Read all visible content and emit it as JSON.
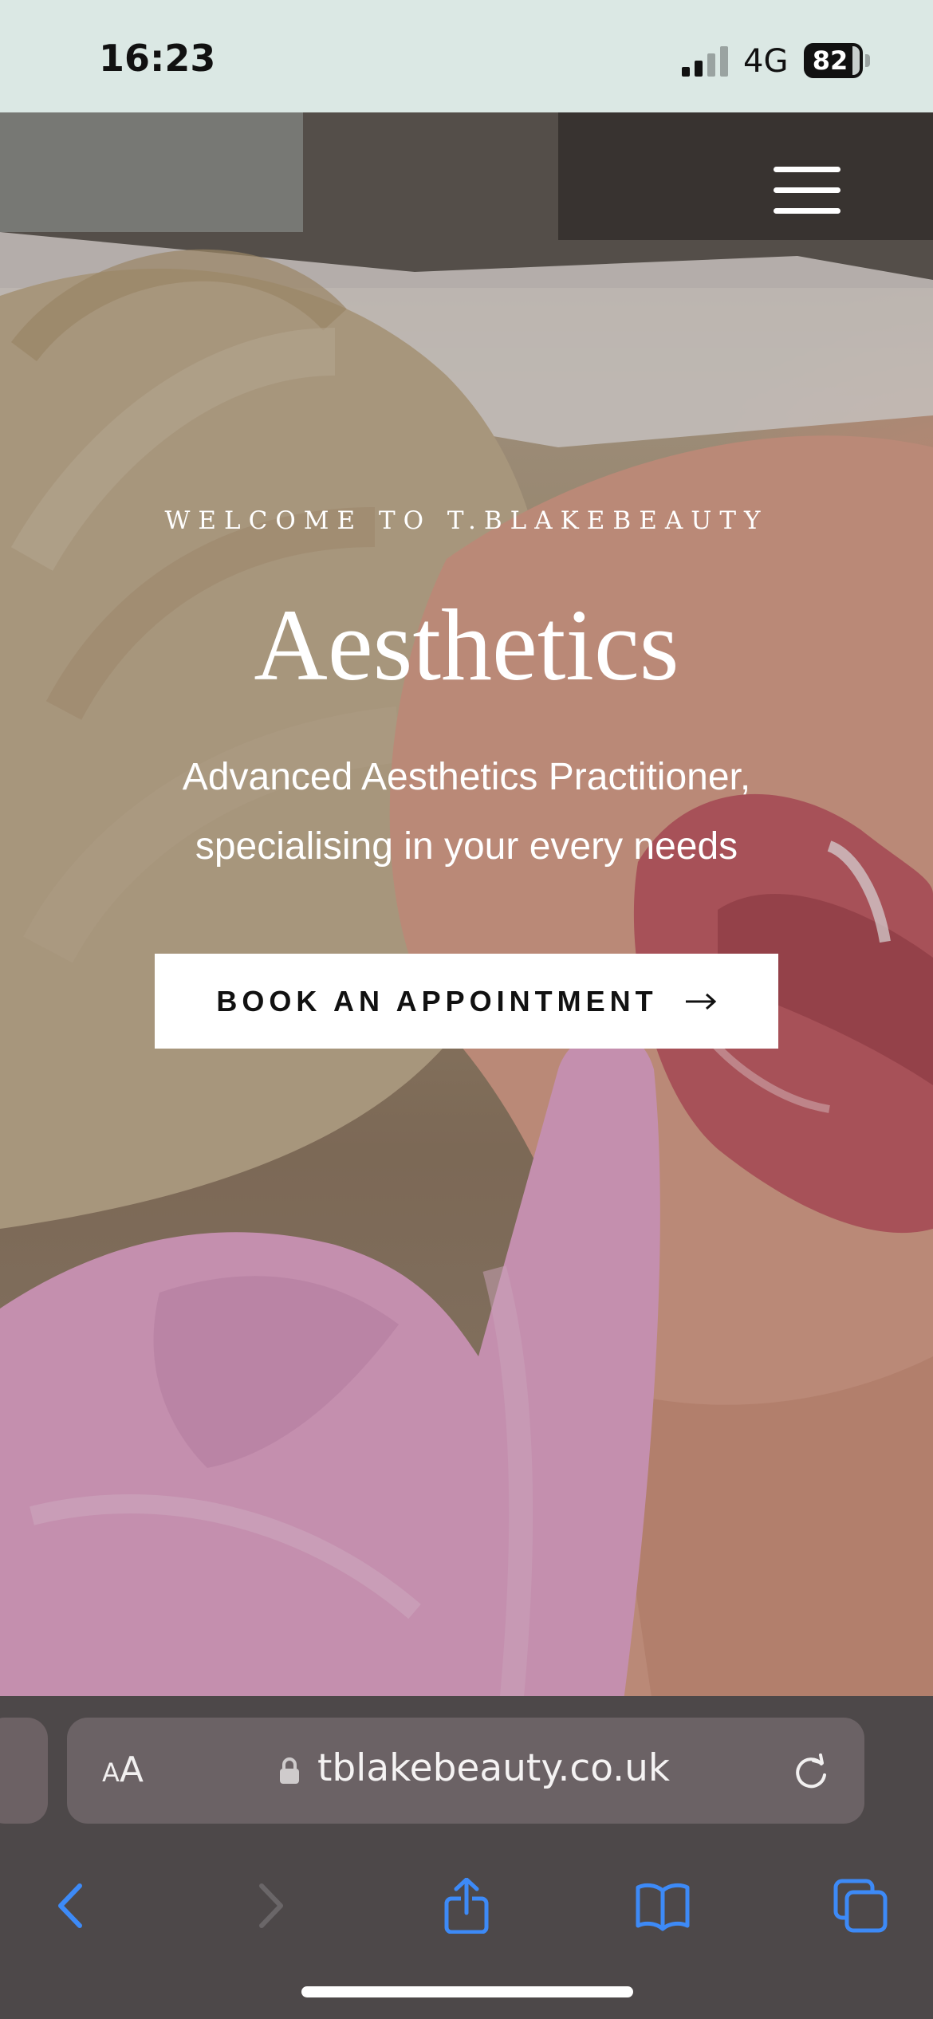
{
  "status_bar": {
    "time": "16:23",
    "network": "4G",
    "battery_level": "82",
    "signal_bars_active": 2,
    "signal_bars_total": 4
  },
  "hero": {
    "menu_icon": "hamburger-menu-icon",
    "welcome": "WELCOME TO T.BLAKEBEAUTY",
    "title": "Aesthetics",
    "subtitle_line1": "Advanced Aesthetics Practitioner,",
    "subtitle_line2": "specialising in your every needs",
    "cta_label": "BOOK AN APPOINTMENT",
    "cta_icon": "arrow-right-icon"
  },
  "browser": {
    "text_size_small": "A",
    "text_size_large": "A",
    "url": "tblakebeauty.co.uk",
    "lock_icon": "lock-icon",
    "reload_icon": "reload-icon",
    "toolbar": [
      {
        "name": "back",
        "icon": "chevron-left-icon",
        "enabled": true
      },
      {
        "name": "forward",
        "icon": "chevron-right-icon",
        "enabled": false
      },
      {
        "name": "share",
        "icon": "share-icon",
        "enabled": true
      },
      {
        "name": "bookmarks",
        "icon": "book-icon",
        "enabled": true
      },
      {
        "name": "tabs",
        "icon": "tabs-icon",
        "enabled": true
      }
    ]
  },
  "colors": {
    "status_bar_bg": "#dbe8e4",
    "browser_bg": "#4d4849",
    "address_bg": "#6b6265",
    "accent_blue": "#3d8af7",
    "cta_bg": "#ffffff"
  }
}
